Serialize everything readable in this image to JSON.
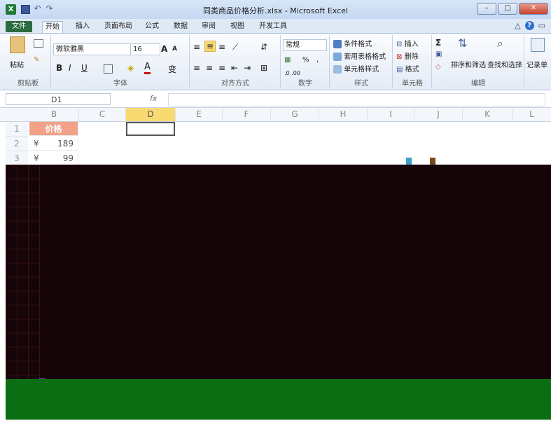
{
  "window": {
    "title": "同类商品价格分析.xlsx - Microsoft Excel",
    "app_icon": "X"
  },
  "ribbon_tabs": [
    "文件",
    "开始",
    "插入",
    "页面布局",
    "公式",
    "数据",
    "审阅",
    "视图",
    "开发工具"
  ],
  "ribbon": {
    "clipboard": {
      "paste": "粘贴",
      "label": "剪贴板"
    },
    "font": {
      "name": "微软雅黑",
      "size": "16",
      "bold": "B",
      "italic": "I",
      "underline": "U",
      "grow": "A",
      "shrink": "A",
      "wen": "变",
      "label": "字体"
    },
    "align": {
      "label": "对齐方式"
    },
    "number": {
      "format": "常规",
      "percent": "%",
      "comma": ",",
      "inc": ".0 .00",
      "dec": ".00 .0",
      "label": "数字"
    },
    "styles": {
      "cond": "条件格式",
      "table": "套用表格格式",
      "cell": "单元格样式",
      "label": "样式"
    },
    "cells": {
      "insert": "插入",
      "delete": "删除",
      "format": "格式",
      "label": "单元格"
    },
    "editing": {
      "sum": "Σ",
      "sort": "排序和筛选",
      "find": "查找和选择",
      "label": "编辑"
    },
    "record": {
      "label": "记录单"
    }
  },
  "namebox": "D1",
  "columns": [
    "B",
    "C",
    "D",
    "E",
    "F",
    "G",
    "H",
    "I",
    "J",
    "K",
    "L"
  ],
  "rows": [
    {
      "num": "1",
      "b": "价格"
    },
    {
      "num": "2",
      "currency": "¥",
      "value": "189"
    },
    {
      "num": "3",
      "currency": "¥",
      "value": "99"
    }
  ],
  "colors": {
    "header_fill": "#f3a187",
    "selected_col": "#f9d972",
    "file_tab": "#2c6b3f"
  }
}
